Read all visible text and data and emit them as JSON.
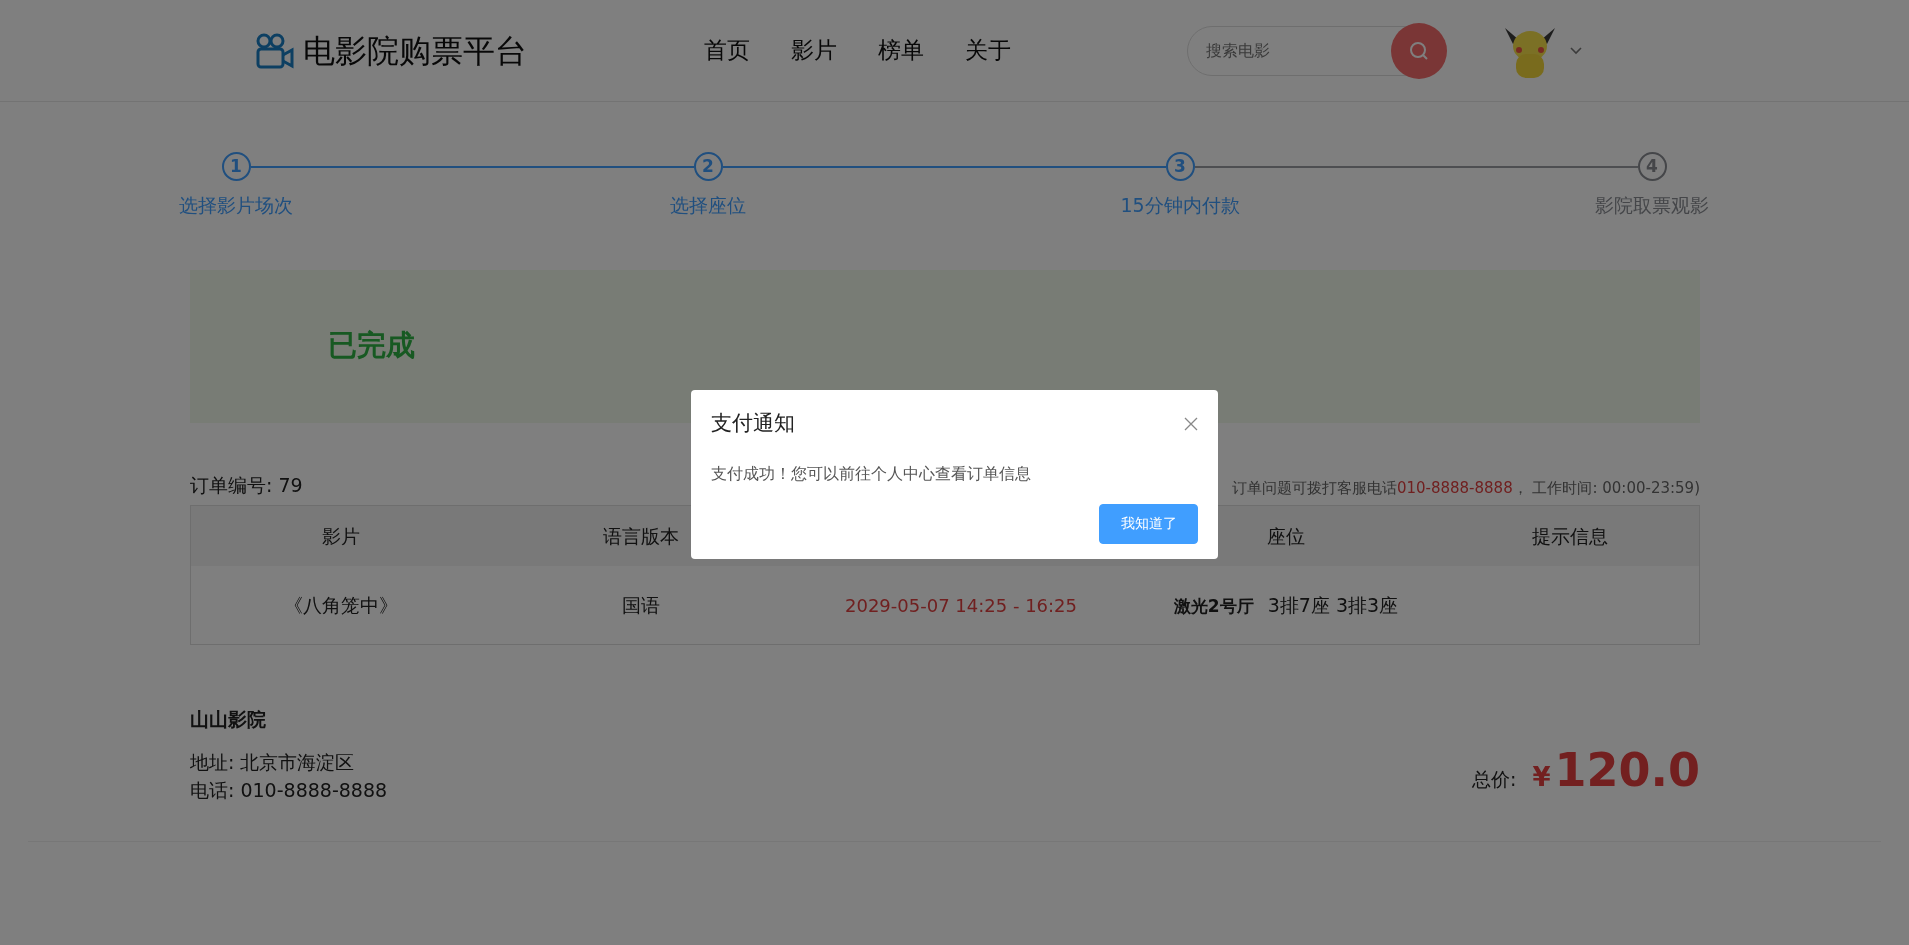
{
  "header": {
    "logo_text": "电影院购票平台",
    "nav": [
      {
        "label": "首页"
      },
      {
        "label": "影片"
      },
      {
        "label": "榜单"
      },
      {
        "label": "关于"
      }
    ],
    "search": {
      "placeholder": "搜索电影"
    }
  },
  "steps": [
    {
      "number": "1",
      "label": "选择影片场次",
      "active": true
    },
    {
      "number": "2",
      "label": "选择座位",
      "active": true
    },
    {
      "number": "3",
      "label": "15分钟内付款",
      "active": true
    },
    {
      "number": "4",
      "label": "影院取票观影",
      "active": false
    }
  ],
  "status_banner": {
    "text": "已完成"
  },
  "order": {
    "number_label": "订单编号: 79",
    "notice": "订单问题可拨打客服电话",
    "notice_phone": "010-8888-8888",
    "notice_hours": "， 工作时间: 00:00-23:59)"
  },
  "table": {
    "columns": [
      "影片",
      "语言版本",
      "",
      "座位",
      "提示信息"
    ],
    "rows": [
      {
        "movie": "《八角笼中》",
        "language": "国语",
        "time": "2029-05-07 14:25 - 16:25",
        "hall": "激光2号厅",
        "seats": "3排7座 3排3座"
      }
    ]
  },
  "cinema": {
    "name": "山山影院",
    "address": "地址: 北京市海淀区",
    "phone": "电话: 010-8888-8888"
  },
  "total": {
    "label": "总价:",
    "currency": "¥",
    "amount": "120.0"
  },
  "dialog": {
    "title": "支付通知",
    "message": "支付成功！您可以前往个人中心查看订单信息",
    "button": "我知道了"
  }
}
